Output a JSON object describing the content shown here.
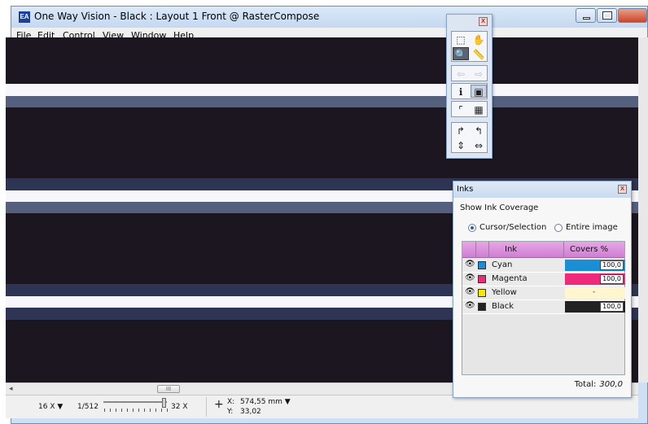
{
  "app": {
    "icon_text": "EA",
    "title": "One Way Vision - Black : Layout 1 Front @ RasterCompose"
  },
  "menu": [
    "File",
    "Edit",
    "Control",
    "View",
    "Window",
    "Help"
  ],
  "status": {
    "zoom": "16 X",
    "ratio_min": "1/512",
    "ratio_max": "32 X",
    "x_label": "X:",
    "x_value": "574,55 mm",
    "y_label": "Y:",
    "y_value": "33,02"
  },
  "scrollbar": {
    "left_arrow": "◂",
    "thumb_grip": "III"
  },
  "toolbox": {
    "close_glyph": "x",
    "tools": [
      {
        "icon": "marquee-select-icon",
        "glyph": "⬚",
        "state": "normal"
      },
      {
        "icon": "hand-pan-icon",
        "glyph": "✋",
        "state": "normal"
      },
      {
        "icon": "zoom-magnifier-icon",
        "glyph": "🔍",
        "state": "active"
      },
      {
        "icon": "measure-ruler-icon",
        "glyph": "📏",
        "state": "normal"
      },
      {
        "icon": "move-left-icon",
        "glyph": "⇦",
        "state": "disabled"
      },
      {
        "icon": "move-right-icon",
        "glyph": "⇨",
        "state": "disabled"
      },
      {
        "icon": "info-icon",
        "glyph": "ℹ",
        "state": "normal"
      },
      {
        "icon": "frame-icon",
        "glyph": "▣",
        "state": "pressed"
      },
      {
        "icon": "corner-icon",
        "glyph": "⌜",
        "state": "normal"
      },
      {
        "icon": "grid-icon",
        "glyph": "▦",
        "state": "normal"
      },
      {
        "icon": "rotate-right-icon",
        "glyph": "↱",
        "state": "normal"
      },
      {
        "icon": "rotate-left-icon",
        "glyph": "↰",
        "state": "normal"
      },
      {
        "icon": "flip-vertical-icon",
        "glyph": "⇕",
        "state": "normal"
      },
      {
        "icon": "flip-horizontal-icon",
        "glyph": "⇔",
        "state": "normal"
      }
    ]
  },
  "inks_panel": {
    "title": "Inks",
    "close_glyph": "x",
    "subtitle": "Show Ink Coverage",
    "radio_options": [
      {
        "label": "Cursor/Selection",
        "selected": true
      },
      {
        "label": "Entire image",
        "selected": false
      }
    ],
    "columns": {
      "ink": "Ink",
      "covers": "Covers %"
    },
    "rows": [
      {
        "name": "Cyan",
        "swatch": "#1a8fd6",
        "bar": "#1a8fd6",
        "value": "100,0"
      },
      {
        "name": "Magenta",
        "swatch": "#ee2a7b",
        "bar": "#ee2a7b",
        "value": "100,0"
      },
      {
        "name": "Yellow",
        "swatch": "#ffe600",
        "bar": "#fff6d0",
        "value": "-"
      },
      {
        "name": "Black",
        "swatch": "#222222",
        "bar": "#222222",
        "value": "100,0"
      }
    ],
    "eye_glyph": "👁",
    "total_label": "Total:",
    "total_value": "300,0"
  }
}
